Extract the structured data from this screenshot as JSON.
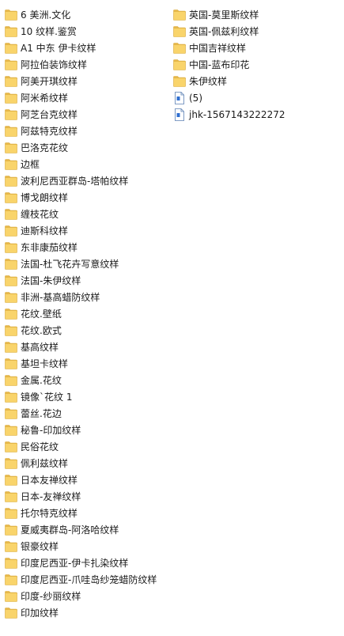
{
  "colors": {
    "folder_fill": "#f9d46b",
    "folder_tab": "#e8b84a",
    "folder_edge": "#d9a93a",
    "file_fill": "#ffffff",
    "file_edge": "#5a7fb3",
    "file_mark": "#2f6fd1",
    "text": "#1a1a1a"
  },
  "left_column": [
    {
      "label": "6 美洲.文化",
      "icon": "folder-icon"
    },
    {
      "label": "10 纹样.鉴赏",
      "icon": "folder-icon"
    },
    {
      "label": "A1 中东 伊卡纹样",
      "icon": "folder-icon"
    },
    {
      "label": "阿拉伯装饰纹样",
      "icon": "folder-icon"
    },
    {
      "label": "阿美开琪纹样",
      "icon": "folder-icon"
    },
    {
      "label": "阿米希纹样",
      "icon": "folder-icon"
    },
    {
      "label": "阿芝台克纹样",
      "icon": "folder-icon"
    },
    {
      "label": "阿兹特克纹样",
      "icon": "folder-icon"
    },
    {
      "label": "巴洛克花纹",
      "icon": "folder-icon"
    },
    {
      "label": "边框",
      "icon": "folder-icon"
    },
    {
      "label": "波利尼西亚群岛-塔帕纹样",
      "icon": "folder-icon"
    },
    {
      "label": "博戈朗纹样",
      "icon": "folder-icon"
    },
    {
      "label": "缠枝花纹",
      "icon": "folder-icon"
    },
    {
      "label": "迪斯科纹样",
      "icon": "folder-icon"
    },
    {
      "label": "东非康茄纹样",
      "icon": "folder-icon"
    },
    {
      "label": "法国-杜飞花卉写意纹样",
      "icon": "folder-icon"
    },
    {
      "label": "法国-朱伊纹样",
      "icon": "folder-icon"
    },
    {
      "label": "非洲-基高蜡防纹样",
      "icon": "folder-icon"
    },
    {
      "label": "花纹.壁纸",
      "icon": "folder-icon"
    },
    {
      "label": "花纹.欧式",
      "icon": "folder-icon"
    },
    {
      "label": "基高纹样",
      "icon": "folder-icon"
    },
    {
      "label": "基坦卡纹样",
      "icon": "folder-icon"
    },
    {
      "label": "金属.花纹",
      "icon": "folder-icon"
    },
    {
      "label": "镜像`花纹 1",
      "icon": "folder-icon"
    },
    {
      "label": "蕾丝.花边",
      "icon": "folder-icon"
    },
    {
      "label": "秘鲁-印加纹样",
      "icon": "folder-icon"
    },
    {
      "label": "民俗花纹",
      "icon": "folder-icon"
    },
    {
      "label": "佩利兹纹样",
      "icon": "folder-icon"
    },
    {
      "label": "日本友禅纹样",
      "icon": "folder-icon"
    },
    {
      "label": "日本-友禅纹样",
      "icon": "folder-icon"
    },
    {
      "label": "托尔特克纹样",
      "icon": "folder-icon"
    },
    {
      "label": "夏威夷群岛-阿洛哈纹样",
      "icon": "folder-icon"
    },
    {
      "label": "银豪纹样",
      "icon": "folder-icon"
    },
    {
      "label": "印度尼西亚-伊卡扎染纹样",
      "icon": "folder-icon"
    },
    {
      "label": "印度尼西亚-爪哇岛纱笼蜡防纹样",
      "icon": "folder-icon"
    },
    {
      "label": "印度-纱丽纹样",
      "icon": "folder-icon"
    },
    {
      "label": "印加纹样",
      "icon": "folder-icon"
    }
  ],
  "right_column": [
    {
      "label": "英国-莫里斯纹样",
      "icon": "folder-icon"
    },
    {
      "label": "英国-佩兹利纹样",
      "icon": "folder-icon"
    },
    {
      "label": "中国吉祥纹样",
      "icon": "folder-icon"
    },
    {
      "label": "中国-蓝布印花",
      "icon": "folder-icon"
    },
    {
      "label": "朱伊纹样",
      "icon": "folder-icon"
    },
    {
      "label": "(5)",
      "icon": "document-icon"
    },
    {
      "label": "jhk-1567143222272",
      "icon": "document-icon"
    }
  ]
}
